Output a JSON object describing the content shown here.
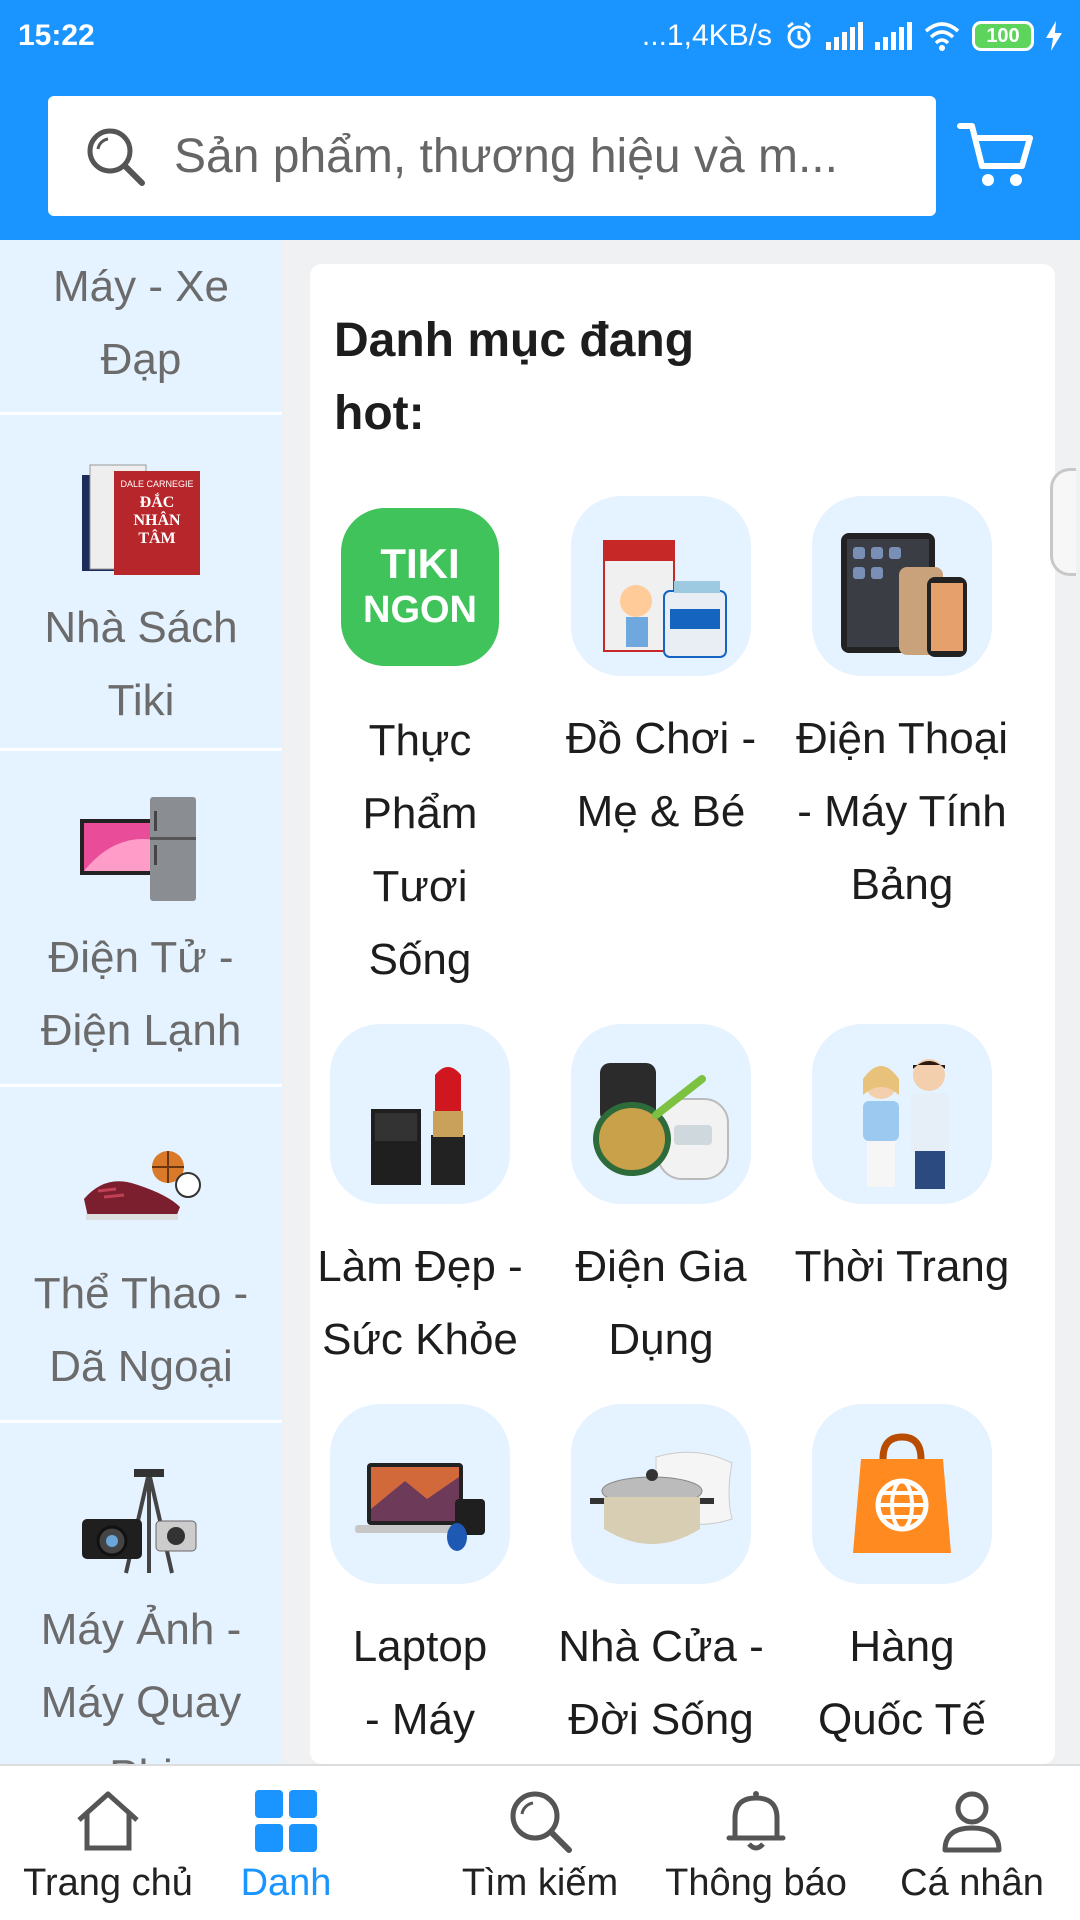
{
  "status": {
    "time": "15:22",
    "speed": "...1,4KB/s",
    "battery": "100"
  },
  "search": {
    "placeholder": "Sản phẩm, thương hiệu và m..."
  },
  "sidebar": {
    "items": [
      {
        "label": "Máy - Xe Đạp",
        "icon": "bicycle"
      },
      {
        "label": "Nhà Sách Tiki",
        "icon": "book-cover"
      },
      {
        "label": "Điện Tử - Điện Lạnh",
        "icon": "tv-fridge"
      },
      {
        "label": "Thể Thao - Dã Ngoại",
        "icon": "sneakers-balls"
      },
      {
        "label": "Máy Ảnh - Máy Quay Phi",
        "icon": "camera-tripod"
      }
    ],
    "book_cover_text": [
      "DALE CARNEGIE",
      "ĐẮC",
      "NHÂN",
      "TÂM"
    ]
  },
  "main": {
    "title": "Danh mục đang hot:",
    "categories": [
      {
        "label": "Thực Phẩm Tươi Sống",
        "icon": "tiki-ngon-logo"
      },
      {
        "label": "Đồ Chơi - Mẹ & Bé",
        "icon": "diapers-milk"
      },
      {
        "label": "Điện Thoại - Máy Tính Bảng",
        "icon": "phones-tablet"
      },
      {
        "label": "Làm Đẹp - Sức Khỏe",
        "icon": "lipstick-perfume"
      },
      {
        "label": "Điện Gia Dụng",
        "icon": "rice-cooker-pan"
      },
      {
        "label": "Thời Trang",
        "icon": "fashion-models"
      },
      {
        "label": "Laptop - Máy Vi",
        "icon": "laptop"
      },
      {
        "label": "Nhà Cửa - Đời Sống",
        "icon": "pot-pillow"
      },
      {
        "label": "Hàng Quốc Tế",
        "icon": "shopping-bag-globe"
      }
    ],
    "tiki_logo": [
      "TIKI",
      "NGON"
    ]
  },
  "bottom_nav": {
    "items": [
      {
        "label": "Trang chủ",
        "icon": "home-icon"
      },
      {
        "label": "Danh",
        "icon": "grid-icon",
        "active": true
      },
      {
        "label": "Tìm kiếm",
        "icon": "search-icon"
      },
      {
        "label": "Thông báo",
        "icon": "bell-icon"
      },
      {
        "label": "Cá nhân",
        "icon": "user-icon"
      }
    ]
  },
  "colors": {
    "brand": "#1a94ff",
    "sidebar_bg": "#e5f2ff",
    "tiki_green": "#3fc35a"
  }
}
